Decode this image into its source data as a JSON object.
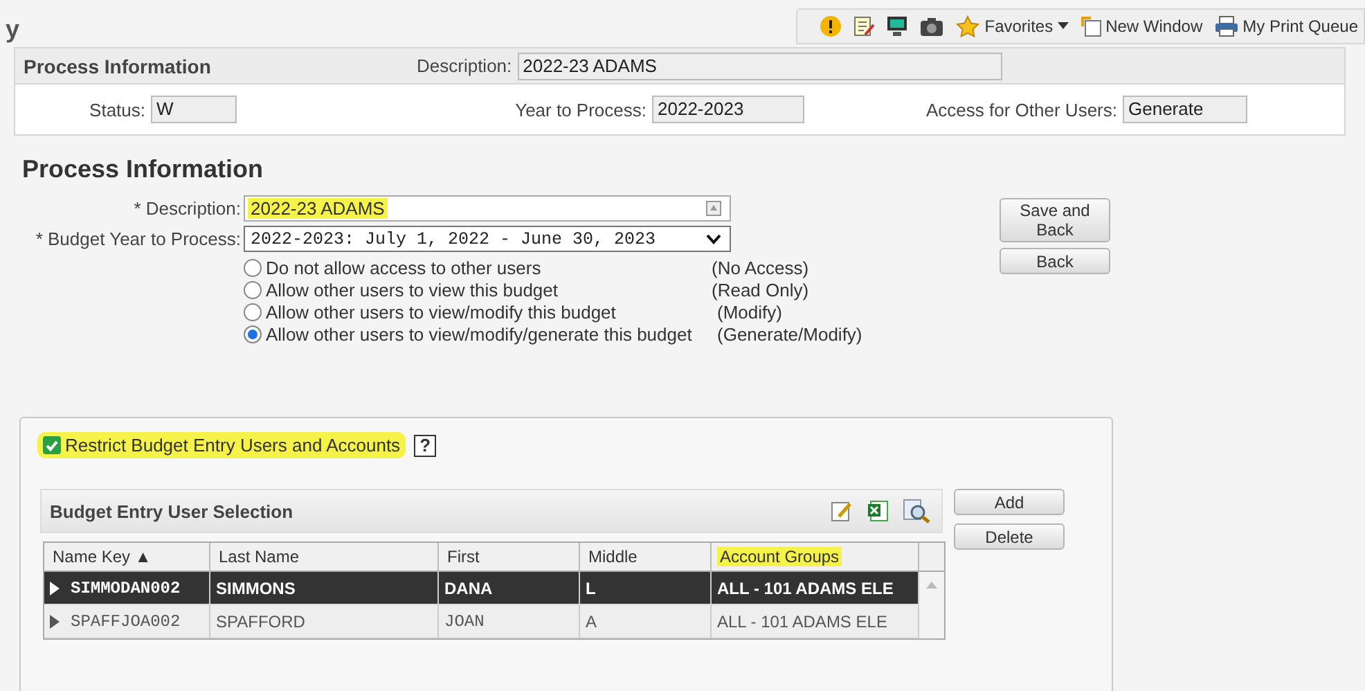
{
  "page_title": "y",
  "toolbar": {
    "items": [
      {
        "kind": "alert"
      },
      {
        "kind": "notes"
      },
      {
        "kind": "monitor"
      },
      {
        "kind": "camera"
      },
      {
        "kind": "favorites",
        "label": "Favorites"
      },
      {
        "kind": "window",
        "label": "New Window"
      },
      {
        "kind": "printer",
        "label": "My Print Queue"
      }
    ]
  },
  "summary": {
    "title": "Process Information",
    "description_label": "Description:",
    "description_value": "2022-23 ADAMS",
    "fields": [
      {
        "label": "Status:",
        "value": "W"
      },
      {
        "label": "Year to Process:",
        "value": "2022-2023"
      },
      {
        "label": "Access for Other Users:",
        "value": "Generate"
      }
    ]
  },
  "form": {
    "title": "Process Information",
    "description": {
      "label": "* Description:",
      "value": "2022-23 ADAMS",
      "highlighted": true
    },
    "budget_year": {
      "label": "* Budget Year to Process:",
      "value": "2022-2023: July 1, 2022 - June 30, 2023"
    },
    "access_options": [
      {
        "label": "Do not allow access to other users",
        "note": "(No Access)",
        "selected": false
      },
      {
        "label": "Allow other users to view this budget",
        "note": "(Read Only)",
        "selected": false
      },
      {
        "label": "Allow other users to view/modify this budget",
        "note": "(Modify)",
        "selected": false
      },
      {
        "label": "Allow other users to view/modify/generate this budget",
        "note": "(Generate/Modify)",
        "selected": true
      }
    ],
    "buttons": [
      {
        "label": "Save and Back"
      },
      {
        "label": "Back"
      }
    ]
  },
  "restrict": {
    "label": "Restrict Budget Entry Users and Accounts",
    "checked": true,
    "highlighted": true,
    "help": "?",
    "grid": {
      "title": "Budget Entry User Selection",
      "columns": [
        {
          "label": "Name Key ▲",
          "highlighted": false
        },
        {
          "label": "Last Name",
          "highlighted": false
        },
        {
          "label": "First",
          "highlighted": false
        },
        {
          "label": "Middle",
          "highlighted": false
        },
        {
          "label": "Account Groups",
          "highlighted": true
        }
      ],
      "rows": [
        {
          "selected": true,
          "cells": [
            "SIMMODAN002",
            "SIMMONS",
            "DANA",
            "L",
            "ALL - 101 ADAMS ELE"
          ]
        },
        {
          "selected": false,
          "cells": [
            "SPAFFJOA002",
            "SPAFFORD",
            "JOAN",
            "A",
            "ALL - 101 ADAMS ELE"
          ]
        }
      ]
    },
    "buttons": [
      {
        "label": "Add"
      },
      {
        "label": "Delete"
      }
    ]
  }
}
